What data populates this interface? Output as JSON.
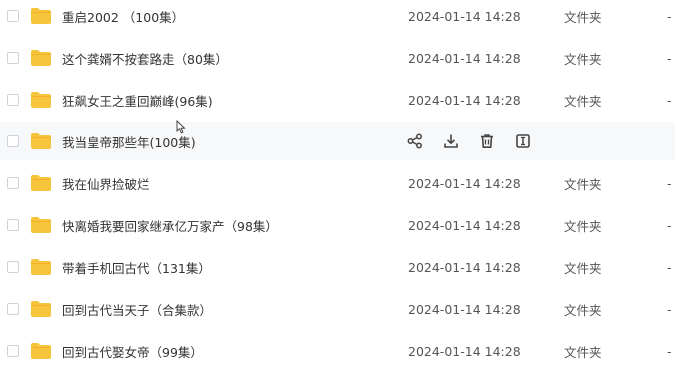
{
  "files": [
    {
      "name": "重启2002 （100集）",
      "modified": "2024-01-14 14:28",
      "type": "文件夹",
      "size": "-"
    },
    {
      "name": "这个龚婿不按套路走（80集）",
      "modified": "2024-01-14 14:28",
      "type": "文件夹",
      "size": "-"
    },
    {
      "name": "狂飙女王之重回巅峰(96集)",
      "modified": "2024-01-14 14:28",
      "type": "文件夹",
      "size": "-"
    },
    {
      "name": "我当皇帝那些年(100集)",
      "hovered": true
    },
    {
      "name": "我在仙界捡破烂",
      "modified": "2024-01-14 14:28",
      "type": "文件夹",
      "size": "-"
    },
    {
      "name": "快离婚我要回家继承亿万家产（98集）",
      "modified": "2024-01-14 14:28",
      "type": "文件夹",
      "size": "-"
    },
    {
      "name": "带着手机回古代（131集）",
      "modified": "2024-01-14 14:28",
      "type": "文件夹",
      "size": "-"
    },
    {
      "name": "回到古代当天子（合集款）",
      "modified": "2024-01-14 14:28",
      "type": "文件夹",
      "size": "-"
    },
    {
      "name": "回到古代娶女帝（99集）",
      "modified": "2024-01-14 14:28",
      "type": "文件夹",
      "size": "-"
    }
  ],
  "row_actions": [
    {
      "icon": "share-icon"
    },
    {
      "icon": "download-icon"
    },
    {
      "icon": "trash-icon"
    },
    {
      "icon": "rename-icon"
    }
  ],
  "colors": {
    "folder": "#f7c53b",
    "folder_tab": "#f3b22a",
    "action_icon": "#444444",
    "hover_bg": "#f7f8fa"
  }
}
